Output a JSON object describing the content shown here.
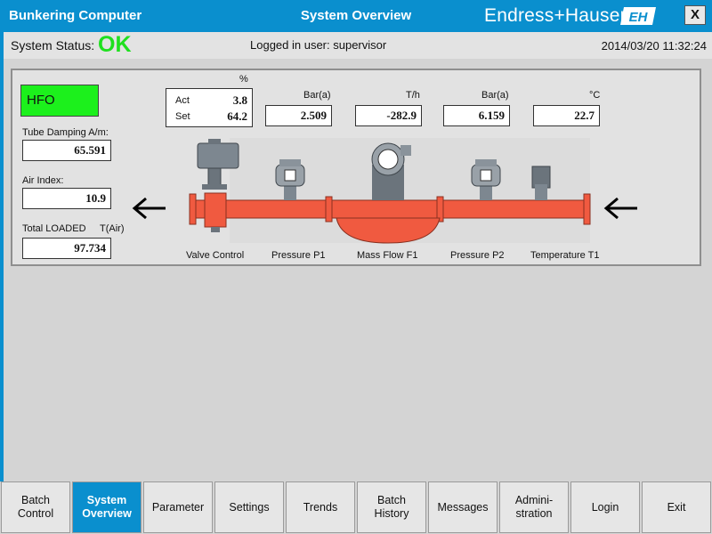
{
  "header": {
    "app_title": "Bunkering Computer",
    "screen_title": "System Overview",
    "brand": "Endress+Hauser",
    "brand_logo_text": "EH",
    "close_label": "X"
  },
  "status": {
    "label": "System Status:",
    "value": "OK",
    "logged_user": "Logged in user: supervisor",
    "datetime": "2014/03/20 11:32:24"
  },
  "overview": {
    "product": "HFO",
    "tube_damping": {
      "label": "Tube Damping A/m:",
      "value": "65.591"
    },
    "air_index": {
      "label": "Air Index:",
      "value": "10.9"
    },
    "total_loaded": {
      "label": "Total LOADED",
      "unit": "T(Air)",
      "value": "97.734"
    },
    "valve": {
      "unit": "%",
      "act_label": "Act",
      "act_value": "3.8",
      "set_label": "Set",
      "set_value": "64.2"
    },
    "readings": [
      {
        "unit": "Bar(a)",
        "value": "2.509"
      },
      {
        "unit": "T/h",
        "value": "-282.9"
      },
      {
        "unit": "Bar(a)",
        "value": "6.159"
      },
      {
        "unit": "°C",
        "value": "22.7"
      }
    ],
    "sensors": [
      "Valve Control",
      "Pressure P1",
      "Mass Flow F1",
      "Pressure P2",
      "Temperature T1"
    ]
  },
  "colors": {
    "accent": "#0a8fce",
    "ok": "#1fe01f",
    "product": "#1cf01c",
    "pipe": "#f05a40"
  },
  "nav": [
    {
      "label": "Batch\nControl",
      "active": false
    },
    {
      "label": "System\nOverview",
      "active": true
    },
    {
      "label": "Parameter",
      "active": false
    },
    {
      "label": "Settings",
      "active": false
    },
    {
      "label": "Trends",
      "active": false
    },
    {
      "label": "Batch\nHistory",
      "active": false
    },
    {
      "label": "Messages",
      "active": false
    },
    {
      "label": "Admini-\nstration",
      "active": false
    },
    {
      "label": "Login",
      "active": false
    },
    {
      "label": "Exit",
      "active": false
    }
  ]
}
